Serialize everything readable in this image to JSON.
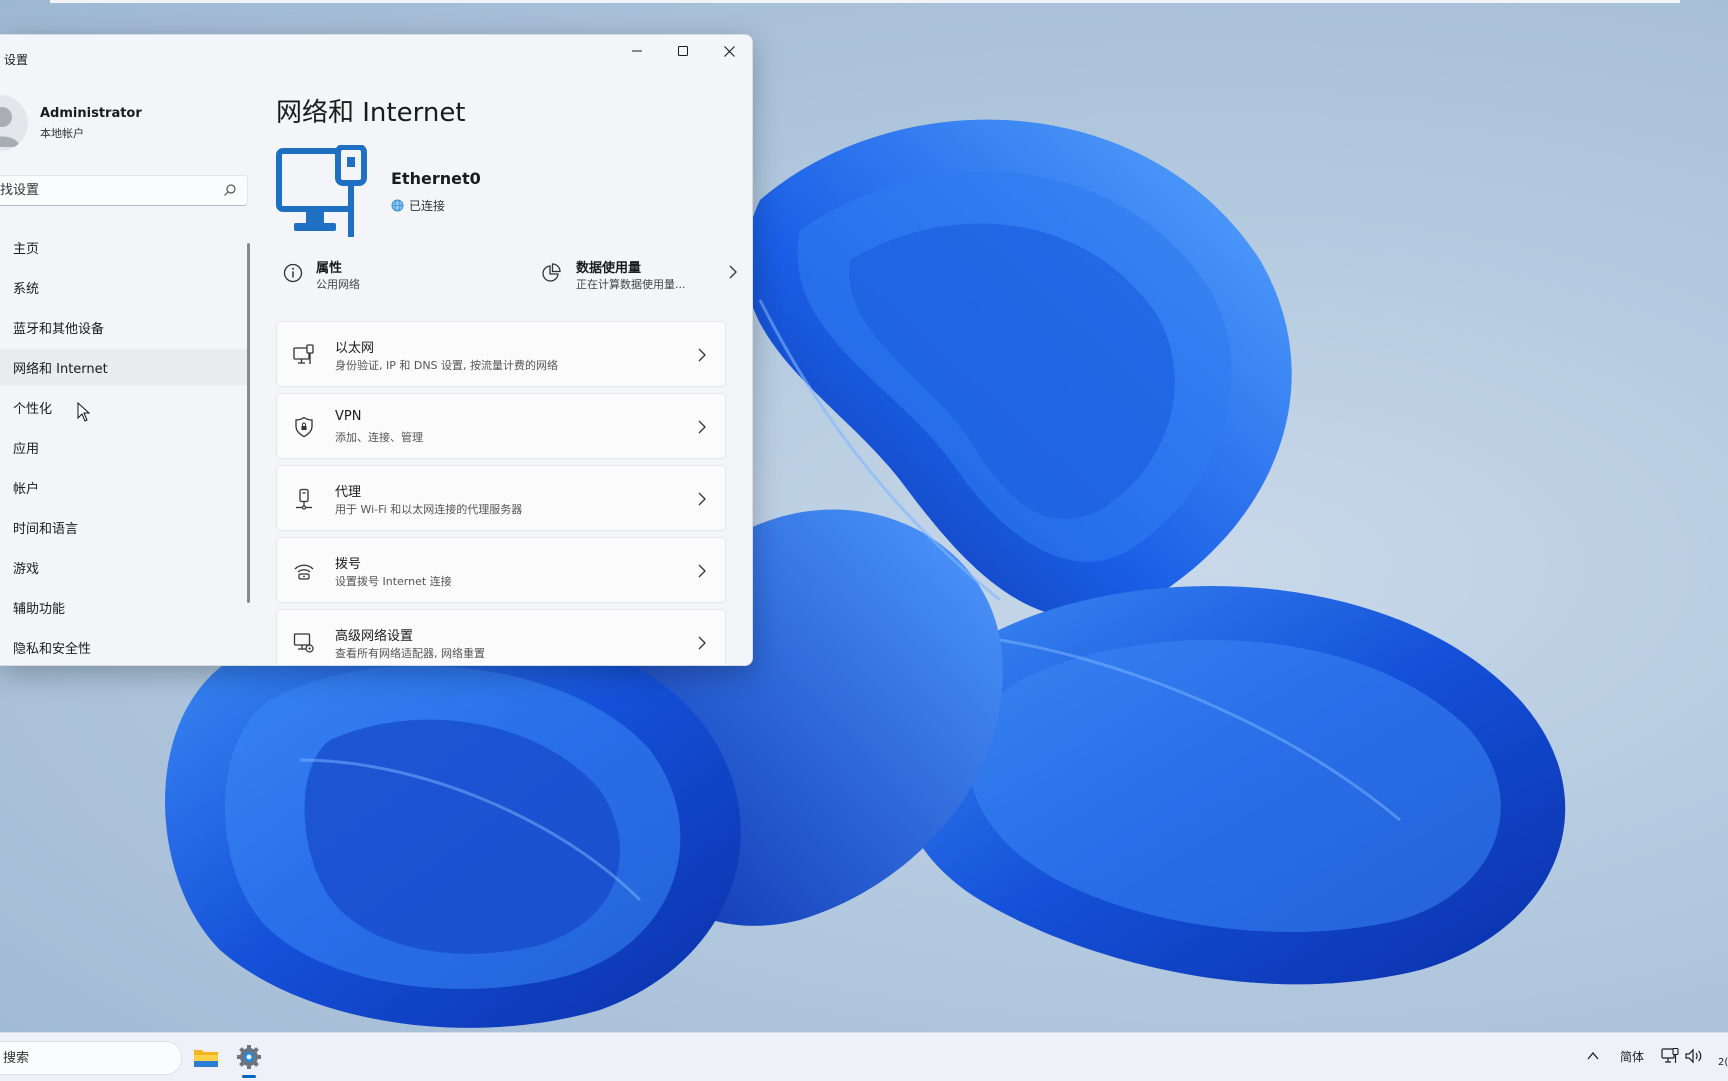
{
  "window": {
    "title": "设置",
    "controls": [
      "minimize-icon",
      "maximize-icon",
      "close-icon"
    ]
  },
  "profile": {
    "name": "Administrator",
    "subtitle": "本地帐户"
  },
  "search": {
    "placeholder": "找设置"
  },
  "sidebar": {
    "items": [
      {
        "label": "主页"
      },
      {
        "label": "系统"
      },
      {
        "label": "蓝牙和其他设备"
      },
      {
        "label": "网络和 Internet",
        "selected": true
      },
      {
        "label": "个性化"
      },
      {
        "label": "应用"
      },
      {
        "label": "帐户"
      },
      {
        "label": "时间和语言"
      },
      {
        "label": "游戏"
      },
      {
        "label": "辅助功能"
      },
      {
        "label": "隐私和安全性"
      }
    ]
  },
  "main": {
    "title": "网络和 Internet",
    "network": {
      "name": "Ethernet0",
      "status": "已连接"
    },
    "properties": {
      "title": "属性",
      "subtitle": "公用网络"
    },
    "data_usage": {
      "title": "数据使用量",
      "subtitle": "正在计算数据使用量..."
    },
    "cards": [
      {
        "title": "以太网",
        "subtitle": "身份验证, IP 和 DNS 设置, 按流量计费的网络",
        "icon": "ethernet-icon"
      },
      {
        "title": "VPN",
        "subtitle": "添加、连接、管理",
        "icon": "vpn-shield-icon"
      },
      {
        "title": "代理",
        "subtitle": "用于 Wi-Fi 和以太网连接的代理服务器",
        "icon": "proxy-icon"
      },
      {
        "title": "拨号",
        "subtitle": "设置拨号 Internet 连接",
        "icon": "dialup-icon"
      },
      {
        "title": "高级网络设置",
        "subtitle": "查看所有网络适配器, 网络重置",
        "icon": "advanced-network-icon"
      }
    ]
  },
  "taskbar": {
    "search_placeholder": "搜索",
    "language": "简体",
    "clock_partial": "2("
  },
  "colors": {
    "accent": "#0067c0",
    "hero_icon": "#1f6fc3"
  }
}
